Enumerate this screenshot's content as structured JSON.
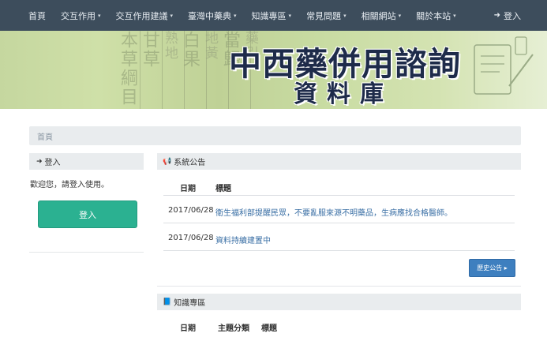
{
  "nav": {
    "items": [
      {
        "label": "首頁",
        "dropdown": false
      },
      {
        "label": "交互作用",
        "dropdown": true
      },
      {
        "label": "交互作用建議",
        "dropdown": true
      },
      {
        "label": "臺灣中藥典",
        "dropdown": true
      },
      {
        "label": "知識專區",
        "dropdown": true
      },
      {
        "label": "常見問題",
        "dropdown": true
      },
      {
        "label": "相關網站",
        "dropdown": true
      },
      {
        "label": "關於本站",
        "dropdown": true
      }
    ],
    "login_label": "登入",
    "caret_glyph": "▾"
  },
  "banner": {
    "title_line1": "中西藥併用諮詢",
    "title_line2": "資料庫",
    "bg_chars": [
      "本草綱目",
      "甘草",
      "熟地",
      "白果",
      "地黃",
      "當歸",
      "藥引"
    ]
  },
  "breadcrumb": {
    "label": "首頁"
  },
  "login_panel": {
    "heading": "登入",
    "welcome": "歡迎您，請登入使用。",
    "button_label": "登入"
  },
  "announcements": {
    "heading": "系統公告",
    "col_date": "日期",
    "col_title": "標題",
    "rows": [
      {
        "date": "2017/06/28",
        "title": "衛生福利部提醒民眾，不要亂服來源不明藥品，生病應找合格醫師。"
      },
      {
        "date": "2017/06/28",
        "title": "資料持續建置中"
      }
    ],
    "more_label": "歷史公告 ▸"
  },
  "knowledge": {
    "heading": "知識專區",
    "col_date": "日期",
    "col_category": "主題分類",
    "col_title": "標題"
  },
  "colors": {
    "navbar": "#3d4d5c",
    "login_button": "#2bb191",
    "more_button": "#3e7fbf",
    "link": "#3a6fa5",
    "panel_head": "#e9ecee"
  }
}
